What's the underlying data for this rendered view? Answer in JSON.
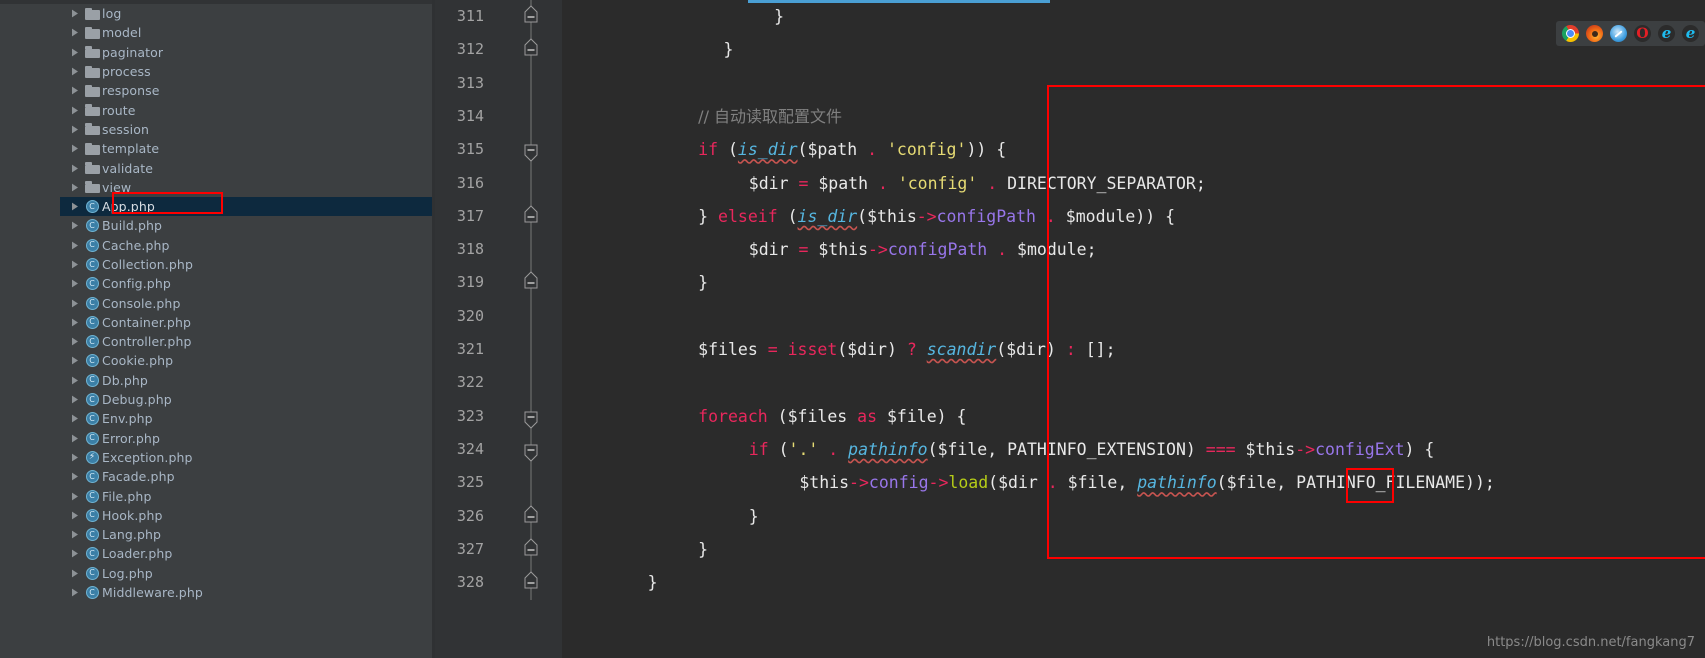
{
  "window": {
    "theme_background": "#2b2b2b",
    "panel_background": "#3c3f41",
    "accent": "#4a9fd4",
    "annotation_color": "#fe0000"
  },
  "project_tree": {
    "name": "project-file-tree",
    "selected_item": "App.php",
    "items": [
      {
        "label": "log",
        "kind": "folder"
      },
      {
        "label": "model",
        "kind": "folder"
      },
      {
        "label": "paginator",
        "kind": "folder"
      },
      {
        "label": "process",
        "kind": "folder"
      },
      {
        "label": "response",
        "kind": "folder"
      },
      {
        "label": "route",
        "kind": "folder"
      },
      {
        "label": "session",
        "kind": "folder"
      },
      {
        "label": "template",
        "kind": "folder"
      },
      {
        "label": "validate",
        "kind": "folder"
      },
      {
        "label": "view",
        "kind": "folder"
      },
      {
        "label": "App.php",
        "kind": "php-class",
        "selected": true,
        "annotated": true
      },
      {
        "label": "Build.php",
        "kind": "php-class"
      },
      {
        "label": "Cache.php",
        "kind": "php-class"
      },
      {
        "label": "Collection.php",
        "kind": "php-class"
      },
      {
        "label": "Config.php",
        "kind": "php-class"
      },
      {
        "label": "Console.php",
        "kind": "php-class"
      },
      {
        "label": "Container.php",
        "kind": "php-class"
      },
      {
        "label": "Controller.php",
        "kind": "php-class"
      },
      {
        "label": "Cookie.php",
        "kind": "php-class"
      },
      {
        "label": "Db.php",
        "kind": "php-class"
      },
      {
        "label": "Debug.php",
        "kind": "php-class"
      },
      {
        "label": "Env.php",
        "kind": "php-class"
      },
      {
        "label": "Error.php",
        "kind": "php-class"
      },
      {
        "label": "Exception.php",
        "kind": "php-exception"
      },
      {
        "label": "Facade.php",
        "kind": "php-class"
      },
      {
        "label": "File.php",
        "kind": "php-class"
      },
      {
        "label": "Hook.php",
        "kind": "php-class"
      },
      {
        "label": "Lang.php",
        "kind": "php-class"
      },
      {
        "label": "Loader.php",
        "kind": "php-class"
      },
      {
        "label": "Log.php",
        "kind": "php-class"
      },
      {
        "label": "Middleware.php",
        "kind": "php-class"
      }
    ]
  },
  "editor": {
    "name": "code-editor",
    "language": "php",
    "first_line": 311,
    "lines": [
      {
        "number": "311",
        "fold": "collapse-end",
        "indent": 7,
        "text": "}"
      },
      {
        "number": "312",
        "fold": "collapse-end",
        "indent": 5,
        "text": "}"
      },
      {
        "number": "313",
        "fold": "none",
        "indent": 0,
        "text": ""
      },
      {
        "number": "314",
        "fold": "none",
        "indent": 4,
        "text": "// 自动读取配置文件"
      },
      {
        "number": "315",
        "fold": "collapse-start",
        "indent": 4,
        "text": "if (is_dir($path . 'config')) {"
      },
      {
        "number": "316",
        "fold": "none",
        "indent": 6,
        "text": "$dir = $path . 'config' . DIRECTORY_SEPARATOR;"
      },
      {
        "number": "317",
        "fold": "collapse-end",
        "indent": 4,
        "text": "} elseif (is_dir($this->configPath . $module)) {"
      },
      {
        "number": "318",
        "fold": "none",
        "indent": 6,
        "text": "$dir = $this->configPath . $module;"
      },
      {
        "number": "319",
        "fold": "collapse-end",
        "indent": 4,
        "text": "}"
      },
      {
        "number": "320",
        "fold": "none",
        "indent": 0,
        "text": ""
      },
      {
        "number": "321",
        "fold": "none",
        "indent": 4,
        "text": "$files = isset($dir) ? scandir($dir) : [];"
      },
      {
        "number": "322",
        "fold": "none",
        "indent": 0,
        "text": ""
      },
      {
        "number": "323",
        "fold": "collapse-start",
        "indent": 4,
        "text": "foreach ($files as $file) {"
      },
      {
        "number": "324",
        "fold": "collapse-start",
        "indent": 6,
        "text": "if ('.' . pathinfo($file, PATHINFO_EXTENSION) === $this->configExt) {"
      },
      {
        "number": "325",
        "fold": "none",
        "indent": 8,
        "text": "$this->config->load($dir . $file, pathinfo($file, PATHINFO_FILENAME));"
      },
      {
        "number": "326",
        "fold": "collapse-end",
        "indent": 6,
        "text": "}"
      },
      {
        "number": "327",
        "fold": "collapse-end",
        "indent": 4,
        "text": "}"
      },
      {
        "number": "328",
        "fold": "collapse-end",
        "indent": 2,
        "text": "}"
      }
    ],
    "highlighted_token": "load",
    "syntax_colors": {
      "comment": "#808080",
      "keyword": "#e8275c",
      "function": "#56b6e0",
      "string": "#e6db74",
      "property": "#9876ea",
      "method": "#b5cc18",
      "default": "#a9b7c6"
    }
  },
  "browser_bar": {
    "name": "browser-preview-bar",
    "browsers": [
      {
        "name": "chrome-icon",
        "label": ""
      },
      {
        "name": "firefox-icon",
        "label": ""
      },
      {
        "name": "safari-icon",
        "label": ""
      },
      {
        "name": "opera-icon",
        "label": "O"
      },
      {
        "name": "internet-explorer-icon",
        "label": "e"
      },
      {
        "name": "edge-icon",
        "label": "e"
      }
    ]
  },
  "watermark": {
    "text": "https://blog.csdn.net/fangkang7"
  }
}
